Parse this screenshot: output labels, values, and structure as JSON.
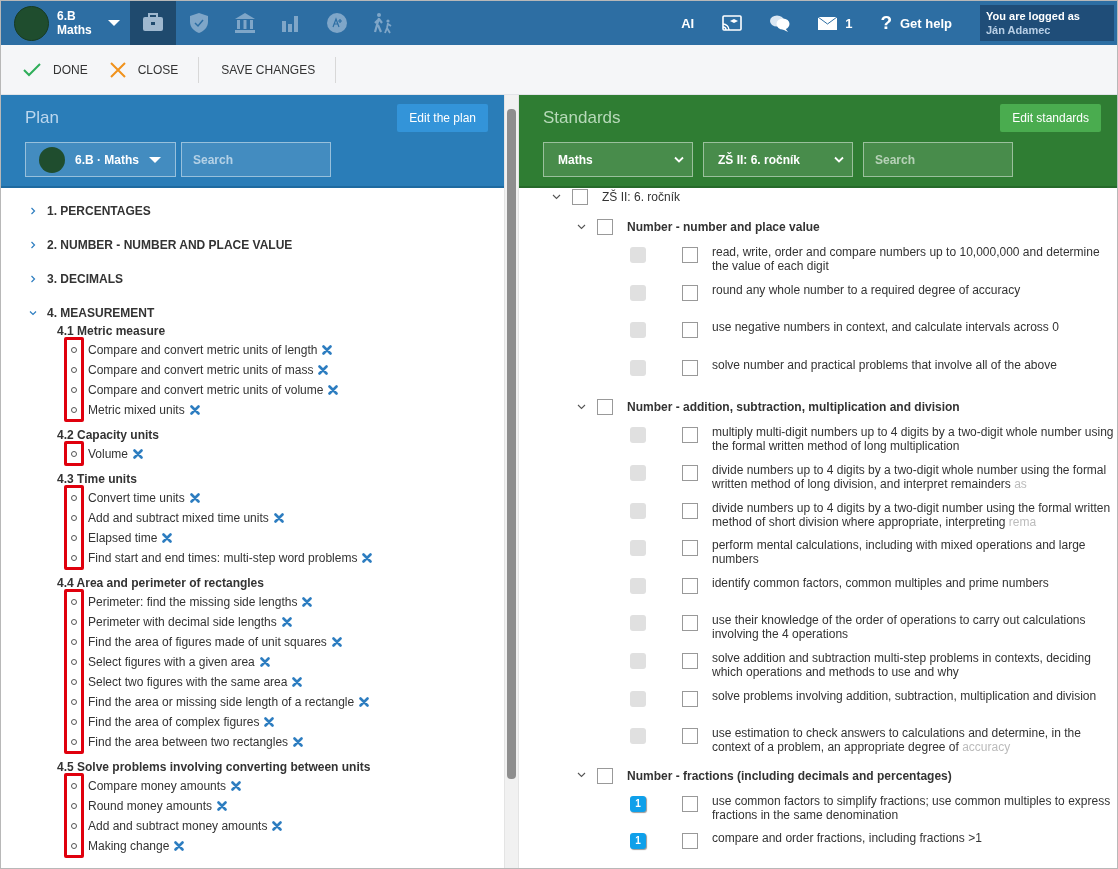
{
  "topbar": {
    "class_name": "6.B",
    "subject": "Maths",
    "nav_icons": [
      {
        "kind": "briefcase",
        "selected": true
      },
      {
        "kind": "shield",
        "selected": false
      },
      {
        "kind": "bank",
        "selected": false
      },
      {
        "kind": "bars",
        "selected": false
      },
      {
        "kind": "grade",
        "selected": false
      },
      {
        "kind": "walkers",
        "selected": false
      }
    ],
    "ai_label": "AI",
    "mail_count": "1",
    "help_icon": "?",
    "help_label": "Get help",
    "user": {
      "caption": "You are logged as",
      "name": "Ján Adamec"
    }
  },
  "toolbar": {
    "buttons": [
      {
        "kind": "done",
        "label": "DONE"
      },
      {
        "kind": "close",
        "label": "CLOSE"
      },
      {
        "kind": "plain",
        "label": "SAVE CHANGES"
      }
    ]
  },
  "plan": {
    "title": "Plan",
    "edit_button": "Edit the plan",
    "class_select": "6.B · Maths",
    "search": {
      "placeholder": "Search"
    },
    "topics": [
      {
        "label": "1. PERCENTAGES",
        "expanded": false
      },
      {
        "label": "2. NUMBER - NUMBER AND PLACE VALUE",
        "expanded": false
      },
      {
        "label": "3. DECIMALS",
        "expanded": false
      },
      {
        "label": "4. MEASUREMENT",
        "expanded": true,
        "sections": [
          {
            "title": "4.1 Metric measure",
            "highlighted": true,
            "items": [
              "Compare and convert metric units of length",
              "Compare and convert metric units of mass",
              "Compare and convert metric units of volume",
              "Metric mixed units"
            ]
          },
          {
            "title": "4.2 Capacity units",
            "highlighted": true,
            "items": [
              "Volume"
            ]
          },
          {
            "title": "4.3 Time units",
            "highlighted": true,
            "items": [
              "Convert time units",
              "Add and subtract mixed time units",
              "Elapsed time",
              "Find start and end times: multi-step word problems"
            ]
          },
          {
            "title": "4.4 Area and perimeter of rectangles",
            "highlighted": true,
            "items": [
              "Perimeter: find the missing side lengths",
              "Perimeter with decimal side lengths",
              "Find the area of figures made of unit squares",
              "Select figures with a given area",
              "Select two figures with the same area",
              "Find the area or missing side length of a rectangle",
              "Find the area of complex figures",
              "Find the area between two rectangles"
            ]
          },
          {
            "title": "4.5 Solve problems involving converting between units",
            "highlighted": true,
            "items": [
              "Compare money amounts",
              "Round money amounts",
              "Add and subtract money amounts",
              "Making change"
            ]
          }
        ]
      }
    ]
  },
  "standards": {
    "title": "Standards",
    "edit_button": "Edit standards",
    "subject_select": "Maths",
    "grade_select": "ZŠ II: 6. ročník",
    "search": {
      "placeholder": "Search"
    },
    "tree": [
      {
        "kind": "group",
        "label": "ZŠ II: 6. ročník",
        "expanded": true,
        "checked": false,
        "children": [
          {
            "kind": "group",
            "label": "Number - number and place value",
            "expanded": true,
            "checked": false,
            "children": [
              {
                "kind": "standard",
                "checked": false,
                "label": "read, write, order and compare numbers up to 10,000,000 and determine the value of each digit"
              },
              {
                "kind": "standard",
                "checked": false,
                "label": "round any whole number to a required degree of accuracy"
              },
              {
                "kind": "standard",
                "checked": false,
                "label": "use negative numbers in context, and calculate intervals across 0"
              },
              {
                "kind": "standard",
                "checked": false,
                "label": "solve number and practical problems that involve all of the above"
              }
            ]
          },
          {
            "kind": "group",
            "label": "Number - addition, subtraction, multiplication and division",
            "expanded": true,
            "checked": false,
            "children": [
              {
                "kind": "standard",
                "checked": false,
                "label": "multiply multi-digit numbers up to 4 digits by a two-digit whole number using the formal written method of long multiplication"
              },
              {
                "kind": "standard",
                "checked": false,
                "label": "divide numbers up to 4 digits by a two-digit whole number using the formal written method of long division, and interpret remainders",
                "faded_tail": "as"
              },
              {
                "kind": "standard",
                "checked": false,
                "label": "divide numbers up to 4 digits by a two-digit number using the formal written method of short division where appropriate, interpreting",
                "faded_tail": "rema"
              },
              {
                "kind": "standard",
                "checked": false,
                "label": "perform mental calculations, including with mixed operations and large numbers"
              },
              {
                "kind": "standard",
                "checked": false,
                "label": "identify common factors, common multiples and prime numbers"
              },
              {
                "kind": "standard",
                "checked": false,
                "label": "use their knowledge of the order of operations to carry out calculations involving the 4 operations"
              },
              {
                "kind": "standard",
                "checked": false,
                "label": "solve addition and subtraction multi-step problems in contexts, deciding which operations and methods to use and why"
              },
              {
                "kind": "standard",
                "checked": false,
                "label": "solve problems involving addition, subtraction, multiplication and division"
              },
              {
                "kind": "standard",
                "checked": false,
                "label": "use estimation to check answers to calculations and determine, in the context of a problem, an appropriate degree of",
                "faded_tail": "accuracy"
              }
            ]
          },
          {
            "kind": "group",
            "label": "Number - fractions (including decimals and percentages)",
            "expanded": true,
            "checked": false,
            "children": [
              {
                "kind": "standard",
                "checked": false,
                "count": "1",
                "label": "use common factors to simplify fractions; use common multiples to express fractions in the same denomination"
              },
              {
                "kind": "standard",
                "checked": false,
                "count": "1",
                "label": "compare and order fractions, including fractions >1"
              }
            ]
          }
        ]
      }
    ]
  }
}
